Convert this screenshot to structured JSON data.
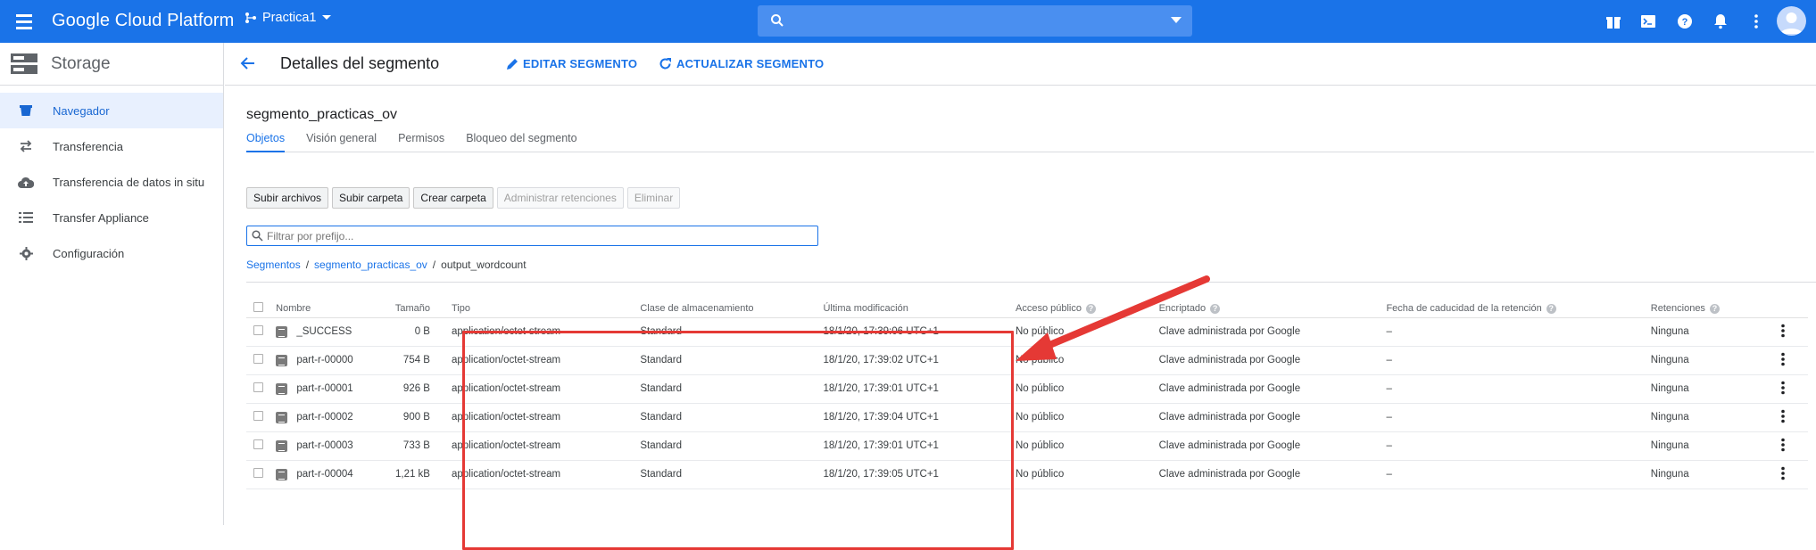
{
  "topbar": {
    "brand": "Google Cloud Platform",
    "project": "Practica1",
    "search_placeholder": ""
  },
  "sidebar": {
    "title": "Storage",
    "items": [
      {
        "label": "Navegador",
        "icon": "bucket-icon",
        "active": true
      },
      {
        "label": "Transferencia",
        "icon": "transfer-icon"
      },
      {
        "label": "Transferencia de datos in situ",
        "icon": "cloud-upload-icon"
      },
      {
        "label": "Transfer Appliance",
        "icon": "list-icon"
      },
      {
        "label": "Configuración",
        "icon": "gear-icon"
      }
    ]
  },
  "header": {
    "title": "Detalles del segmento",
    "edit_label": "EDITAR SEGMENTO",
    "refresh_label": "ACTUALIZAR SEGMENTO"
  },
  "bucket_name": "segmento_practicas_ov",
  "tabs": [
    "Objetos",
    "Visión general",
    "Permisos",
    "Bloqueo del segmento"
  ],
  "buttons": {
    "upload_files": "Subir archivos",
    "upload_folder": "Subir carpeta",
    "create_folder": "Crear carpeta",
    "manage_retention": "Administrar retenciones",
    "delete": "Eliminar"
  },
  "filter": {
    "placeholder": "Filtrar por prefijo..."
  },
  "breadcrumb": {
    "root": "Segmentos",
    "bucket": "segmento_practicas_ov",
    "folder": "output_wordcount",
    "separator": "/"
  },
  "table": {
    "headers": {
      "name": "Nombre",
      "size": "Tamaño",
      "type": "Tipo",
      "storage_class": "Clase de almacenamiento",
      "modified": "Última modificación",
      "public_access": "Acceso público",
      "encryption": "Encriptado",
      "retention_expiry": "Fecha de caducidad de la retención",
      "holds": "Retenciones"
    },
    "rows": [
      {
        "name": "_SUCCESS",
        "size": "0 B",
        "type": "application/octet-stream",
        "storage_class": "Standard",
        "modified": "18/1/20, 17:39:06 UTC+1",
        "public_access": "No público",
        "encryption": "Clave administrada por Google",
        "retention_expiry": "–",
        "holds": "Ninguna"
      },
      {
        "name": "part-r-00000",
        "size": "754 B",
        "type": "application/octet-stream",
        "storage_class": "Standard",
        "modified": "18/1/20, 17:39:02 UTC+1",
        "public_access": "No público",
        "encryption": "Clave administrada por Google",
        "retention_expiry": "–",
        "holds": "Ninguna"
      },
      {
        "name": "part-r-00001",
        "size": "926 B",
        "type": "application/octet-stream",
        "storage_class": "Standard",
        "modified": "18/1/20, 17:39:01 UTC+1",
        "public_access": "No público",
        "encryption": "Clave administrada por Google",
        "retention_expiry": "–",
        "holds": "Ninguna"
      },
      {
        "name": "part-r-00002",
        "size": "900 B",
        "type": "application/octet-stream",
        "storage_class": "Standard",
        "modified": "18/1/20, 17:39:04 UTC+1",
        "public_access": "No público",
        "encryption": "Clave administrada por Google",
        "retention_expiry": "–",
        "holds": "Ninguna"
      },
      {
        "name": "part-r-00003",
        "size": "733 B",
        "type": "application/octet-stream",
        "storage_class": "Standard",
        "modified": "18/1/20, 17:39:01 UTC+1",
        "public_access": "No público",
        "encryption": "Clave administrada por Google",
        "retention_expiry": "–",
        "holds": "Ninguna"
      },
      {
        "name": "part-r-00004",
        "size": "1,21 kB",
        "type": "application/octet-stream",
        "storage_class": "Standard",
        "modified": "18/1/20, 17:39:05 UTC+1",
        "public_access": "No público",
        "encryption": "Clave administrada por Google",
        "retention_expiry": "–",
        "holds": "Ninguna"
      }
    ]
  },
  "colors": {
    "brand_blue": "#1a73e8",
    "annotation_red": "#e53935"
  }
}
